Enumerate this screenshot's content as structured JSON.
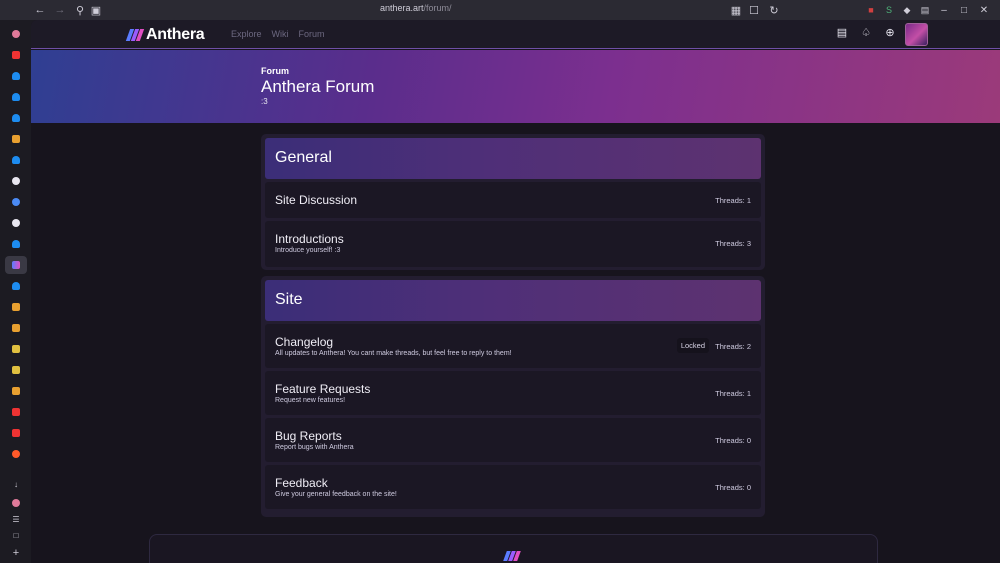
{
  "browser": {
    "url_host": "anthera.art",
    "url_path": "/forum/"
  },
  "nav": {
    "logo_text": "Anthera",
    "links": [
      "Explore",
      "Wiki",
      "Forum"
    ],
    "icons": [
      "list-icon",
      "bell-icon",
      "plus-circle-icon"
    ]
  },
  "hero": {
    "kicker": "Forum",
    "title": "Anthera Forum",
    "subtitle": ":3"
  },
  "categories": [
    {
      "title": "General",
      "boards": [
        {
          "title": "Site Discussion",
          "description": "",
          "threads": "Threads: 1"
        },
        {
          "title": "Introductions",
          "description": "Introduce yourself! :3",
          "threads": "Threads: 3"
        }
      ]
    },
    {
      "title": "Site",
      "boards": [
        {
          "title": "Changelog",
          "description": "All updates to Anthera! You cant make threads, but feel free to reply to them!",
          "threads": "Threads: 2",
          "badge": "Locked"
        },
        {
          "title": "Feature Requests",
          "description": "Request new features!",
          "threads": "Threads: 1"
        },
        {
          "title": "Bug Reports",
          "description": "Report bugs with Anthera",
          "threads": "Threads: 0"
        },
        {
          "title": "Feedback",
          "description": "Give your general feedback on the site!",
          "threads": "Threads: 0"
        }
      ]
    }
  ],
  "colors": {
    "accent": "#6f4fa6",
    "logo_stripes": [
      "#5b7cff",
      "#9a5cff",
      "#e04fc2"
    ]
  }
}
